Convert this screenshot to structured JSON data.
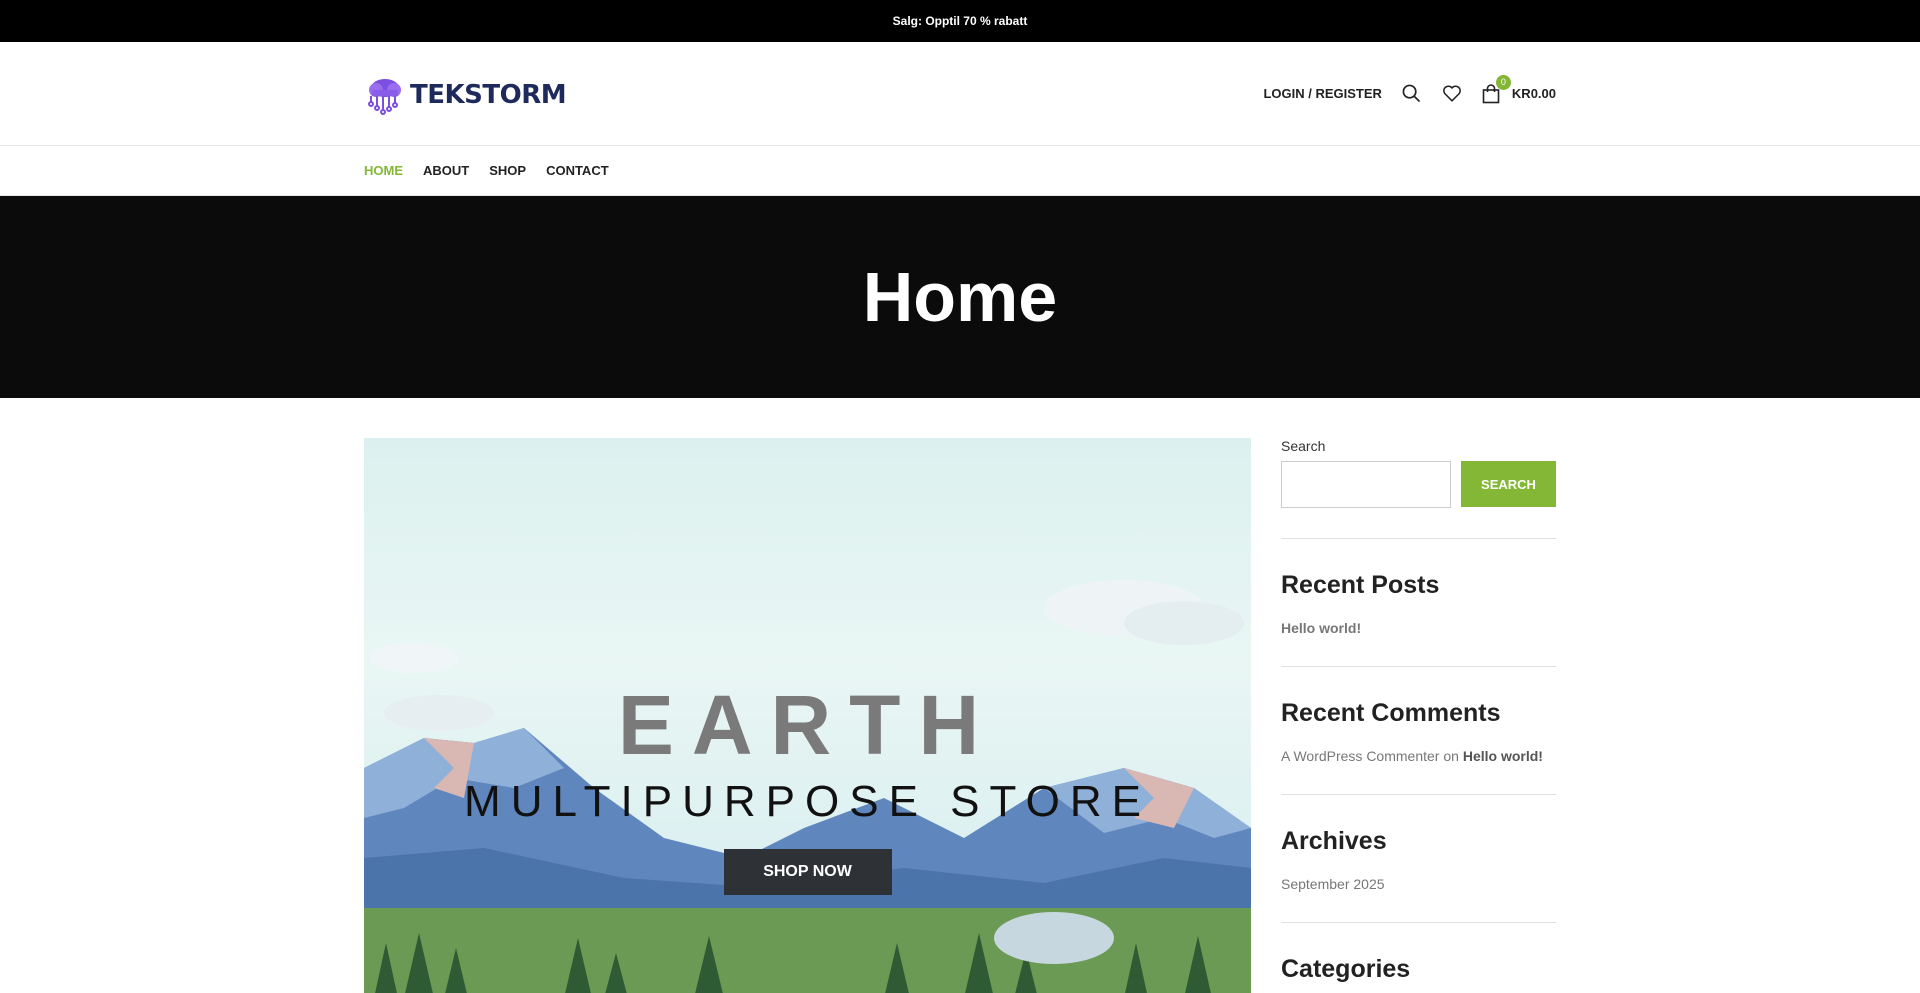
{
  "topbar": {
    "text": "Salg: Opptil 70 % rabatt"
  },
  "header": {
    "logo_text": "TEKSTORM",
    "login_label": "LOGIN / REGISTER",
    "cart_count": "0",
    "cart_total": "KR0.00"
  },
  "nav": {
    "items": [
      {
        "label": "HOME",
        "active": true
      },
      {
        "label": "ABOUT"
      },
      {
        "label": "SHOP"
      },
      {
        "label": "CONTACT"
      }
    ]
  },
  "hero": {
    "title": "Home"
  },
  "banner": {
    "heading": "EARTH",
    "subheading": "MULTIPURPOSE STORE",
    "button": "SHOP NOW"
  },
  "sidebar": {
    "search_label": "Search",
    "search_button": "SEARCH",
    "recent_posts_title": "Recent Posts",
    "recent_posts": [
      "Hello world!"
    ],
    "recent_comments_title": "Recent Comments",
    "comment_author": "A WordPress Commenter",
    "comment_on": "on",
    "comment_post": "Hello world!",
    "archives_title": "Archives",
    "archives": [
      "September 2025"
    ],
    "categories_title": "Categories"
  },
  "colors": {
    "accent": "#83b735",
    "dark": "#0b0b0b",
    "logo": "#7b4fe0"
  }
}
